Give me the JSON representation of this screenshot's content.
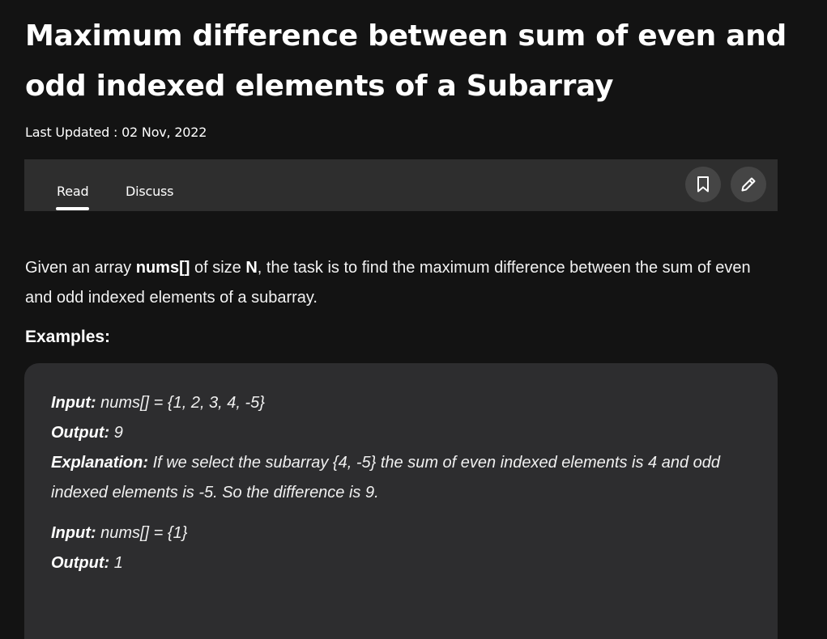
{
  "article": {
    "title": "Maximum difference between sum of even and odd indexed elements of a Subarray",
    "last_updated": "Last Updated : 02 Nov, 2022"
  },
  "tabs": {
    "read": "Read",
    "discuss": "Discuss"
  },
  "icons": {
    "bookmark": "bookmark-icon",
    "edit": "pencil-icon"
  },
  "intro": {
    "text_1": "Given an array ",
    "bold_1": "nums[]",
    "text_2": " of size ",
    "bold_2": "N",
    "text_3": ", the task is to find the maximum difference between the sum of even and odd indexed elements of a subarray."
  },
  "examples_heading": "Examples:",
  "examples": [
    {
      "input_label": "Input:",
      "input_value": " nums[] = {1, 2, 3, 4, -5}",
      "output_label": "Output:",
      "output_value": " 9",
      "explanation_label": "Explanation:",
      "explanation_value": " If we select the subarray {4, -5} the sum of even indexed elements is 4 and odd indexed elements is -5. So the difference is 9."
    },
    {
      "input_label": "Input:",
      "input_value": " nums[] = {1}",
      "output_label": "Output:",
      "output_value": " 1"
    }
  ],
  "colors": {
    "background": "#131313",
    "tabbar": "#2e2e2e",
    "icon_button": "#454545",
    "example_box": "#2d2d2f",
    "text": "#ffffff"
  }
}
